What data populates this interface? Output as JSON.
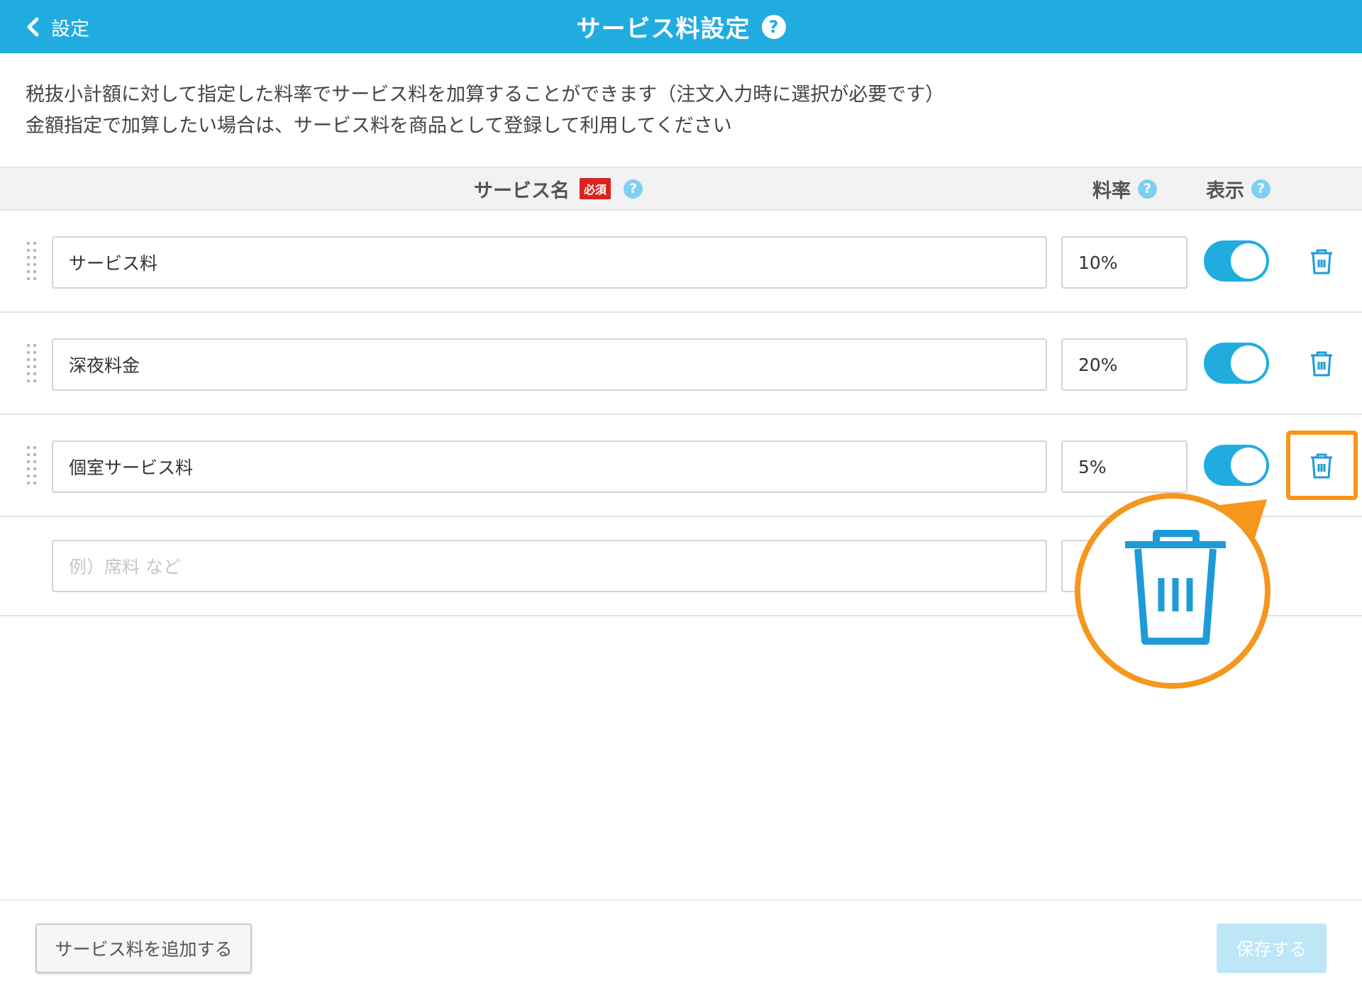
{
  "header": {
    "back_label": "設定",
    "title": "サービス料設定",
    "help_glyph": "?"
  },
  "description": {
    "line1": "税抜小計額に対して指定した料率でサービス料を加算することができます（注文入力時に選択が必要です）",
    "line2": "金額指定で加算したい場合は、サービス料を商品として登録して利用してください"
  },
  "columns": {
    "name": "サービス名",
    "required_badge": "必須",
    "rate": "料率",
    "display": "表示",
    "help_glyph": "?"
  },
  "rows": [
    {
      "name": "サービス料",
      "rate": "10%",
      "display_on": true
    },
    {
      "name": "深夜料金",
      "rate": "20%",
      "display_on": true
    },
    {
      "name": "個室サービス料",
      "rate": "5%",
      "display_on": true
    }
  ],
  "new_row": {
    "name_placeholder": "例）席料 など"
  },
  "footer": {
    "add_label": "サービス料を追加する",
    "save_label": "保存する"
  },
  "colors": {
    "header_bg": "#21ACE0",
    "accent": "#21ACE0",
    "highlight": "#F5961D",
    "required_badge": "#D9231C"
  },
  "icons": [
    "chevron-left-icon",
    "help-icon",
    "drag-handle-icon",
    "trash-icon"
  ]
}
